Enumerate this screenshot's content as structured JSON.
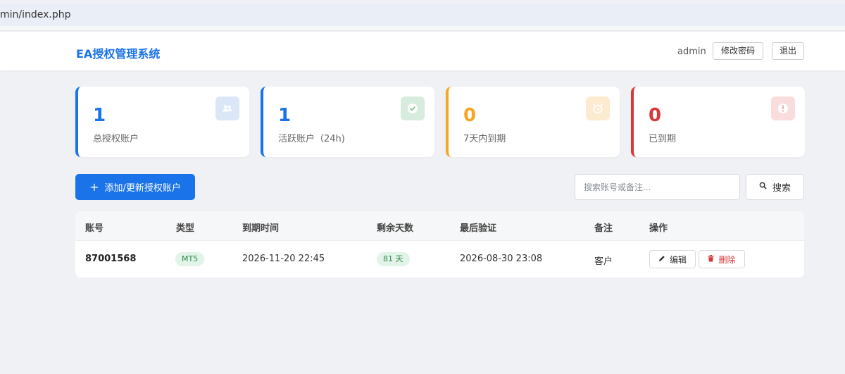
{
  "browser": {
    "url": "min/index.php"
  },
  "header": {
    "title": "EA授权管理系统",
    "user": "admin",
    "change_password": "修改密码",
    "logout": "退出"
  },
  "stats": [
    {
      "value": "1",
      "label": "总授权账户",
      "color": "#1a73e8",
      "icon": "users-icon"
    },
    {
      "value": "1",
      "label": "活跃账户（24h)",
      "color": "#1a73e8",
      "icon": "check-circle-icon"
    },
    {
      "value": "0",
      "label": "7天内到期",
      "color": "#f5a623",
      "icon": "alarm-clock-icon"
    },
    {
      "value": "0",
      "label": "已到期",
      "color": "#d93838",
      "icon": "alert-circle-icon"
    }
  ],
  "toolbar": {
    "add_label": "添加/更新授权账户",
    "search_placeholder": "搜索账号或备注...",
    "search_label": "搜索"
  },
  "table": {
    "headers": [
      "账号",
      "类型",
      "到期时间",
      "剩余天数",
      "最后验证",
      "备注",
      "操作"
    ],
    "rows": [
      {
        "account": "87001568",
        "type": "MT5",
        "expiry": "2026-11-20 22:45",
        "days_left": "81 天",
        "last_verified": "2026-08-30 23:08",
        "note": "客户",
        "edit": "编辑",
        "delete": "删除"
      }
    ]
  }
}
